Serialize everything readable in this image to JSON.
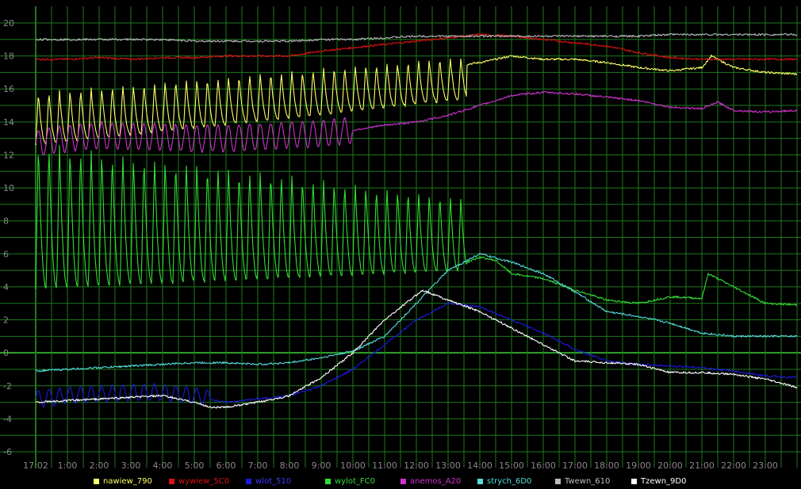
{
  "chart_data": {
    "type": "line",
    "title": "",
    "xlabel": "",
    "ylabel": "",
    "x_ticks": [
      "17:02",
      "1:00",
      "2:00",
      "3:00",
      "4:00",
      "5:00",
      "6:00",
      "7:00",
      "8:00",
      "9:00",
      "10:00",
      "11:00",
      "12:00",
      "13:00",
      "14:00",
      "15:00",
      "16:00",
      "17:00",
      "18:00",
      "19:00",
      "20:00",
      "21:00",
      "22:00",
      "23:00"
    ],
    "y_ticks": [
      20,
      18,
      16,
      14,
      12,
      10,
      8,
      6,
      4,
      2,
      0,
      -2,
      -4,
      -6
    ],
    "ylim": [
      -6,
      20
    ],
    "xlim": [
      0,
      24
    ],
    "grid": true,
    "legend_position": "bottom",
    "colors": {
      "background": "#000000",
      "grid": "#1e7a1e",
      "zero_line": "#2fa52f",
      "tick_text": "#888888"
    },
    "series": [
      {
        "name": "nawiew_790",
        "color": "#ffff66",
        "points": [
          [
            0,
            12
          ],
          [
            0.2,
            15.2
          ],
          [
            0.5,
            12.5
          ],
          [
            1,
            15.7
          ],
          [
            2,
            15
          ],
          [
            3,
            15.5
          ],
          [
            4,
            15.2
          ],
          [
            5,
            15.3
          ],
          [
            6,
            15.1
          ],
          [
            7,
            15.4
          ],
          [
            8,
            15.8
          ],
          [
            9,
            15.9
          ],
          [
            10,
            15.4
          ],
          [
            11,
            16.2
          ],
          [
            12,
            16.5
          ],
          [
            13,
            17
          ],
          [
            13.6,
            17.5
          ],
          [
            14,
            17.6
          ],
          [
            15,
            18
          ],
          [
            16,
            17.8
          ],
          [
            17,
            17.8
          ],
          [
            18,
            17.6
          ],
          [
            19,
            17.3
          ],
          [
            20,
            17.1
          ],
          [
            21,
            17.3
          ],
          [
            21.3,
            18
          ],
          [
            22,
            17.3
          ],
          [
            23,
            17
          ],
          [
            24,
            16.9
          ]
        ],
        "oscillation": {
          "from": 0,
          "to": 13.6,
          "period": 0.333,
          "low": 12.6,
          "low_end": 15.4,
          "high": 15.8,
          "high_end": 18
        }
      },
      {
        "name": "wywiew_5C0",
        "color": "#dd1111",
        "points": [
          [
            0,
            17.8
          ],
          [
            1,
            17.8
          ],
          [
            2,
            17.9
          ],
          [
            3,
            17.8
          ],
          [
            4,
            17.9
          ],
          [
            5,
            17.9
          ],
          [
            6,
            18
          ],
          [
            7,
            18
          ],
          [
            8,
            18
          ],
          [
            9,
            18.3
          ],
          [
            10,
            18.5
          ],
          [
            11,
            18.7
          ],
          [
            12,
            18.9
          ],
          [
            13,
            19.1
          ],
          [
            14,
            19.3
          ],
          [
            15,
            19.2
          ],
          [
            16,
            19
          ],
          [
            17,
            18.8
          ],
          [
            18,
            18.6
          ],
          [
            19,
            18.2
          ],
          [
            20,
            17.9
          ],
          [
            21,
            17.8
          ],
          [
            22,
            17.8
          ],
          [
            23,
            17.8
          ],
          [
            24,
            17.8
          ]
        ]
      },
      {
        "name": "wlot_510",
        "color": "#1a1adc",
        "points": [
          [
            0,
            -2.8
          ],
          [
            1,
            -2.6
          ],
          [
            2,
            -2.5
          ],
          [
            3,
            -2.4
          ],
          [
            4,
            -2.4
          ],
          [
            5,
            -2.6
          ],
          [
            6,
            -3
          ],
          [
            7,
            -2.8
          ],
          [
            8,
            -2.6
          ],
          [
            9,
            -2
          ],
          [
            10,
            -1
          ],
          [
            11,
            0.5
          ],
          [
            12,
            2
          ],
          [
            13,
            3
          ],
          [
            14,
            2.8
          ],
          [
            15,
            2
          ],
          [
            16,
            1.2
          ],
          [
            17,
            0.2
          ],
          [
            18,
            -0.5
          ],
          [
            19,
            -0.7
          ],
          [
            20,
            -0.8
          ],
          [
            21,
            -0.9
          ],
          [
            22,
            -1.1
          ],
          [
            23,
            -1.4
          ],
          [
            24,
            -1.5
          ]
        ],
        "oscillation": {
          "from": 0,
          "to": 5.5,
          "period": 0.333,
          "amplitude": 0.5
        }
      },
      {
        "name": "wylot_FC0",
        "color": "#33dd33",
        "points": [
          [
            0,
            3
          ],
          [
            13.6,
            5.5
          ],
          [
            14,
            5.8
          ],
          [
            14.5,
            5.6
          ],
          [
            15,
            4.8
          ],
          [
            16,
            4.5
          ],
          [
            17,
            3.8
          ],
          [
            18,
            3.2
          ],
          [
            19,
            3
          ],
          [
            20,
            3.4
          ],
          [
            21,
            3.3
          ],
          [
            21.2,
            4.8
          ],
          [
            22,
            4
          ],
          [
            23,
            3
          ],
          [
            24,
            2.9
          ]
        ],
        "oscillation": {
          "from": 0,
          "to": 13.6,
          "period": 0.333,
          "low": 3.9,
          "low_end": 5.0,
          "high": 12.8,
          "high_end": 9.4
        }
      },
      {
        "name": "anemos_A20",
        "color": "#cc33cc",
        "points": [
          [
            0,
            12.7
          ],
          [
            1,
            13
          ],
          [
            2,
            13.2
          ],
          [
            3,
            13.1
          ],
          [
            4,
            13.1
          ],
          [
            5,
            13
          ],
          [
            6,
            13
          ],
          [
            7,
            13.1
          ],
          [
            8,
            13.2
          ],
          [
            9,
            13.3
          ],
          [
            10,
            13.5
          ],
          [
            11,
            13.8
          ],
          [
            12,
            14
          ],
          [
            13,
            14.4
          ],
          [
            14,
            15
          ],
          [
            15,
            15.6
          ],
          [
            16,
            15.8
          ],
          [
            17,
            15.7
          ],
          [
            18,
            15.5
          ],
          [
            19,
            15.3
          ],
          [
            20,
            14.9
          ],
          [
            21,
            14.8
          ],
          [
            21.5,
            15.2
          ],
          [
            22,
            14.7
          ],
          [
            23,
            14.6
          ],
          [
            24,
            14.7
          ]
        ],
        "oscillation": {
          "from": 0,
          "to": 10,
          "period": 0.333,
          "amplitude": 0.8
        }
      },
      {
        "name": "strych_6D0",
        "color": "#55dddd",
        "points": [
          [
            0,
            -1.1
          ],
          [
            1,
            -1
          ],
          [
            2,
            -0.9
          ],
          [
            3,
            -0.8
          ],
          [
            4,
            -0.7
          ],
          [
            5,
            -0.6
          ],
          [
            6,
            -0.6
          ],
          [
            7,
            -0.7
          ],
          [
            8,
            -0.6
          ],
          [
            9,
            -0.3
          ],
          [
            10,
            0.1
          ],
          [
            11,
            1
          ],
          [
            12,
            3
          ],
          [
            13,
            5
          ],
          [
            14,
            6
          ],
          [
            15,
            5.5
          ],
          [
            16,
            4.8
          ],
          [
            17,
            3.7
          ],
          [
            18,
            2.5
          ],
          [
            19,
            2.2
          ],
          [
            20,
            1.8
          ],
          [
            21,
            1.2
          ],
          [
            22,
            1
          ],
          [
            23,
            1
          ],
          [
            24,
            1
          ]
        ]
      },
      {
        "name": "Twewn_610",
        "color": "#bbbbbb",
        "points": [
          [
            0,
            19
          ],
          [
            1,
            19
          ],
          [
            2,
            19
          ],
          [
            3,
            19
          ],
          [
            4,
            19
          ],
          [
            5,
            18.9
          ],
          [
            6,
            18.9
          ],
          [
            7,
            18.9
          ],
          [
            8,
            18.9
          ],
          [
            9,
            19
          ],
          [
            10,
            19
          ],
          [
            11,
            19.1
          ],
          [
            12,
            19.2
          ],
          [
            13,
            19.2
          ],
          [
            14,
            19.2
          ],
          [
            15,
            19.2
          ],
          [
            16,
            19.2
          ],
          [
            17,
            19.2
          ],
          [
            18,
            19.2
          ],
          [
            19,
            19.2
          ],
          [
            20,
            19.3
          ],
          [
            21,
            19.3
          ],
          [
            22,
            19.3
          ],
          [
            23,
            19.3
          ],
          [
            24,
            19.3
          ]
        ]
      },
      {
        "name": "Tzewn_9D0",
        "color": "#ffffff",
        "points": [
          [
            0,
            -3
          ],
          [
            1,
            -2.9
          ],
          [
            2,
            -2.8
          ],
          [
            3,
            -2.7
          ],
          [
            4,
            -2.6
          ],
          [
            5,
            -3
          ],
          [
            5.5,
            -3.3
          ],
          [
            6,
            -3.3
          ],
          [
            7,
            -3
          ],
          [
            8,
            -2.6
          ],
          [
            9,
            -1.5
          ],
          [
            10,
            0
          ],
          [
            11,
            2
          ],
          [
            12,
            3.5
          ],
          [
            12.2,
            3.8
          ],
          [
            13,
            3.2
          ],
          [
            14,
            2.5
          ],
          [
            15,
            1.5
          ],
          [
            16,
            0.5
          ],
          [
            17,
            -0.5
          ],
          [
            18,
            -0.6
          ],
          [
            19,
            -0.7
          ],
          [
            20,
            -1.2
          ],
          [
            21,
            -1.2
          ],
          [
            22,
            -1.3
          ],
          [
            23,
            -1.6
          ],
          [
            24,
            -2.1
          ]
        ]
      }
    ]
  }
}
